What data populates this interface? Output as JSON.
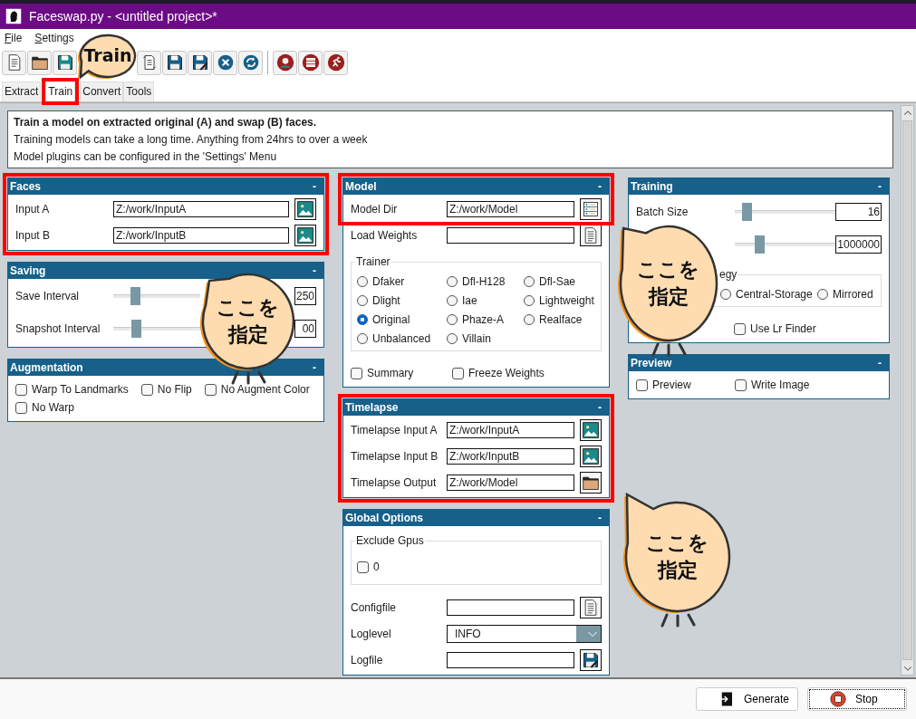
{
  "window": {
    "title": "Faceswap.py - <untitled project>*"
  },
  "menu": [
    {
      "label": "File"
    },
    {
      "label": "Settings"
    }
  ],
  "tabs": [
    {
      "label": "Extract",
      "selected": false
    },
    {
      "label": "Train",
      "selected": true
    },
    {
      "label": "Convert",
      "selected": false
    },
    {
      "label": "Tools",
      "selected": false
    }
  ],
  "info": {
    "heading": "Train a model on extracted original (A) and swap (B) faces.",
    "lines": [
      "Training models can take a long time. Anything from 24hrs to over a week",
      "Model plugins can be configured in the 'Settings' Menu"
    ]
  },
  "columns": [
    [
      {
        "title": "Faces",
        "toggle": "-",
        "rows": [
          {
            "kind": "image-field",
            "label": "Input A",
            "value": "Z:/work/InputA"
          },
          {
            "kind": "image-field",
            "label": "Input B",
            "value": "Z:/work/InputB"
          }
        ]
      },
      {
        "title": "Saving",
        "toggle": "-",
        "rows": [
          {
            "kind": "slider",
            "label": "Save Interval",
            "level": 0.22,
            "value": "250"
          },
          {
            "kind": "slider",
            "label": "Snapshot Interval",
            "level": 0.23,
            "value": "00"
          }
        ]
      },
      {
        "title": "Augmentation",
        "toggle": "-",
        "rows": [
          {
            "kind": "checks",
            "items": [
              {
                "label": "Warp To Landmarks",
                "checked": false
              },
              {
                "label": "No Flip",
                "checked": false
              },
              {
                "label": "No Augment Color",
                "checked": false
              },
              {
                "label": "No Warp",
                "checked": false
              }
            ]
          }
        ]
      }
    ],
    [
      {
        "title": "Model",
        "toggle": "-",
        "rows": [
          {
            "kind": "store-field",
            "label": "Model Dir",
            "value": "Z:/work/Model"
          },
          {
            "kind": "file-field",
            "label": "Load Weights"
          },
          {
            "kind": "radios",
            "legend": "Trainer",
            "items": [
              {
                "label": "Dfaker",
                "selected": false
              },
              {
                "label": "Dfl-H128",
                "selected": false
              },
              {
                "label": "Dfl-Sae",
                "selected": false
              },
              {
                "label": "Dlight",
                "selected": false
              },
              {
                "label": "Iae",
                "selected": false
              },
              {
                "label": "Lightweight",
                "selected": false
              },
              {
                "label": "Original",
                "selected": true
              },
              {
                "label": "Phaze-A",
                "selected": false
              },
              {
                "label": "Realface",
                "selected": false
              },
              {
                "label": "Unbalanced",
                "selected": false
              },
              {
                "label": "Villain",
                "selected": false
              }
            ]
          },
          {
            "kind": "checks",
            "items": [
              {
                "label": "Summary",
                "checked": false
              },
              {
                "label": "Freeze Weights",
                "checked": false
              }
            ]
          }
        ]
      },
      {
        "title": "Timelapse",
        "toggle": "-",
        "rows": [
          {
            "kind": "image-field",
            "label": "Timelapse Input A",
            "value": "Z:/work/InputA"
          },
          {
            "kind": "image-field",
            "label": "Timelapse Input B",
            "value": "Z:/work/InputB"
          },
          {
            "kind": "folder-field",
            "label": "Timelapse Output",
            "value": "Z:/work/Model"
          }
        ]
      },
      {
        "title": "Global Options",
        "toggle": "-",
        "rows": [
          {
            "kind": "checkgroup",
            "legend": "Exclude Gpus",
            "items": [
              {
                "label": "0",
                "checked": false
              }
            ]
          },
          {
            "kind": "file-field",
            "label": "Configfile"
          },
          {
            "kind": "dropdown",
            "label": "Loglevel",
            "value": "INFO"
          },
          {
            "kind": "save-field",
            "label": "Logfile"
          }
        ]
      }
    ],
    [
      {
        "title": "Training",
        "toggle": "-",
        "rows": [
          {
            "kind": "slider",
            "label": "Batch Size",
            "level": 0.08,
            "value": "16"
          },
          {
            "kind": "slider",
            "level": 0.22,
            "value": "1000000"
          },
          {
            "kind": "radios",
            "legend": "egy",
            "items": [
              {
                "label": "Central-Storage",
                "selected": false
              },
              {
                "label": "Mirrored",
                "selected": false
              }
            ]
          },
          {
            "kind": "checks",
            "items": [
              {
                "label": "Use Lr Finder",
                "checked": false
              }
            ]
          }
        ]
      },
      {
        "title": "Preview",
        "toggle": "-",
        "rows": [
          {
            "kind": "checks",
            "items": [
              {
                "label": "Preview",
                "checked": false
              },
              {
                "label": "Write Image",
                "checked": false
              }
            ]
          }
        ]
      }
    ]
  ],
  "buttons": [
    {
      "label": "Generate",
      "kind": "generate",
      "focused": false
    },
    {
      "label": "Stop",
      "kind": "stop",
      "focused": true
    }
  ],
  "callouts": [
    {
      "text": "Train"
    },
    {
      "text": "ここを指定"
    },
    {
      "text": "ここを指定"
    },
    {
      "text": "ここを指定"
    }
  ]
}
